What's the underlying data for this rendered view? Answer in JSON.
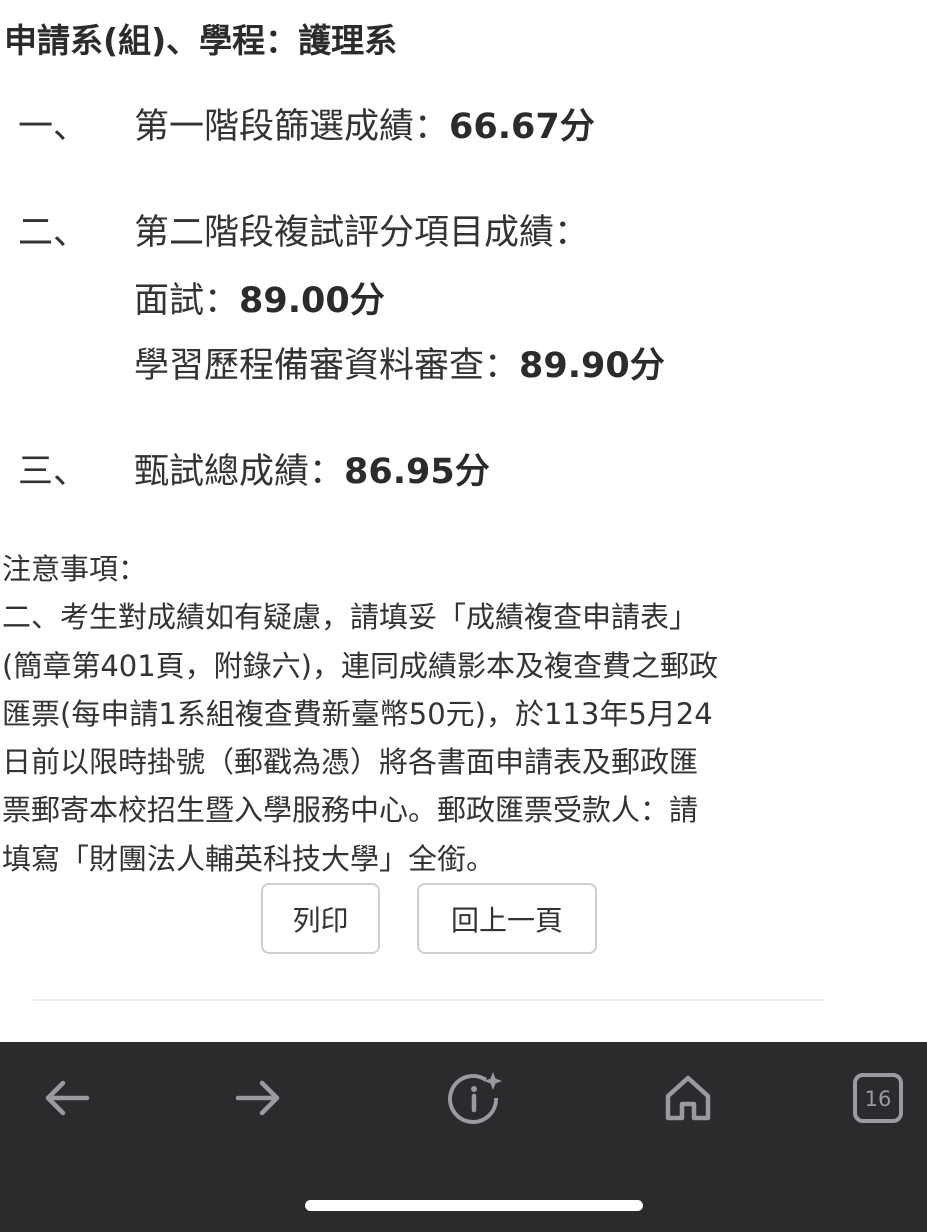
{
  "department": {
    "title": "申請系(組)、學程：護理系"
  },
  "results": {
    "stage1": {
      "num": "一、",
      "label": "第一階段篩選成績：",
      "value": "66.67分"
    },
    "stage2": {
      "num": "二、",
      "label": "第二階段複試評分項目成績：",
      "items": [
        {
          "label": "面試：",
          "value": "89.00分"
        },
        {
          "label": "學習歷程備審資料審查：",
          "value": "89.90分"
        }
      ]
    },
    "total": {
      "num": "三、",
      "label": "甄試總成績：",
      "value": "86.95分"
    }
  },
  "notes": {
    "heading": "注意事項：",
    "lines": [
      "二、考生對成績如有疑慮，請填妥「成績複查申請表」",
      "(簡章第401頁，附錄六)，連同成績影本及複查費之郵政",
      "匯票(每申請1系組複查費新臺幣50元)，於113年5月24",
      "日前以限時掛號（郵戳為憑）將各書面申請表及郵政匯",
      "票郵寄本校招生暨入學服務中心。郵政匯票受款人：請",
      "填寫「財團法人輔英科技大學」全銜。"
    ]
  },
  "buttons": {
    "print": "列印",
    "back": "回上一頁"
  },
  "browser": {
    "tab_count": "16",
    "icons": [
      "back-arrow-icon",
      "forward-arrow-icon",
      "info-sparkle-icon",
      "home-icon",
      "tabs-icon"
    ],
    "bar_color": "#2b2b2e",
    "icon_color": "#9a9aa0"
  }
}
